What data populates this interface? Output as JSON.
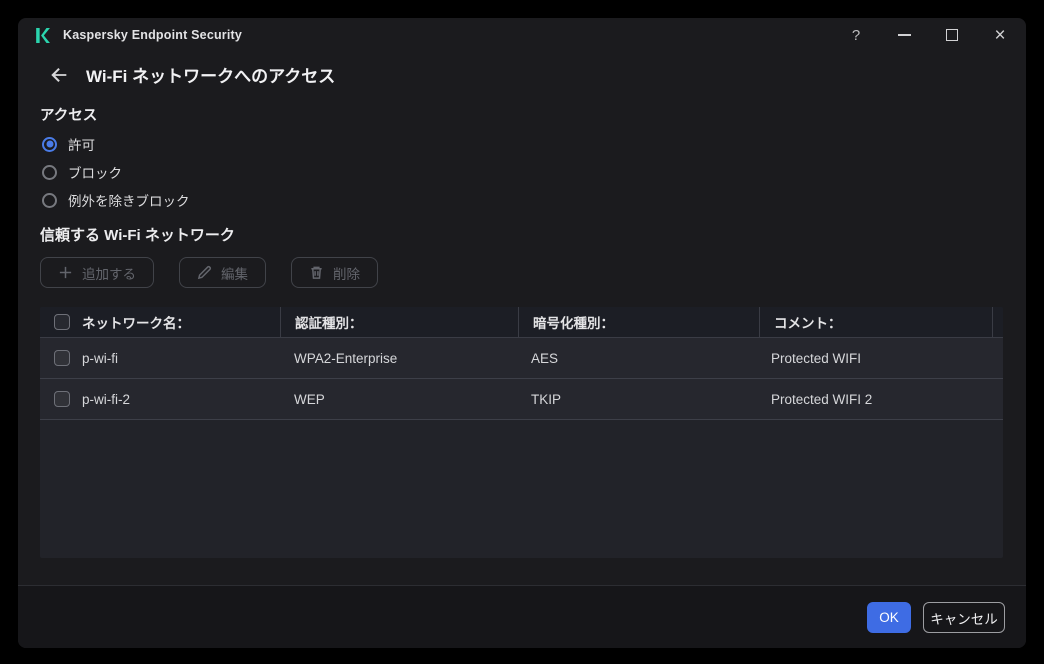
{
  "window": {
    "title": "Kaspersky Endpoint Security",
    "controls": {
      "help": "?",
      "close": "×"
    }
  },
  "header": {
    "title": "Wi-Fi ネットワークへのアクセス"
  },
  "access": {
    "label": "アクセス",
    "options": [
      {
        "label": "許可",
        "selected": true
      },
      {
        "label": "ブロック",
        "selected": false
      },
      {
        "label": "例外を除きブロック",
        "selected": false
      }
    ]
  },
  "trusted": {
    "label": "信頼する Wi-Fi ネットワーク",
    "toolbar": {
      "add": "追加する",
      "edit": "編集",
      "delete": "削除"
    },
    "table": {
      "columns": [
        "ネットワーク名：",
        "認証種別：",
        "暗号化種別：",
        "コメント："
      ],
      "rows": [
        {
          "name": "p-wi-fi",
          "auth": "WPA2-Enterprise",
          "encryption": "AES",
          "comment": "Protected WIFI",
          "checked": false
        },
        {
          "name": "p-wi-fi-2",
          "auth": "WEP",
          "encryption": "TKIP",
          "comment": "Protected WIFI 2",
          "checked": false
        }
      ]
    }
  },
  "footer": {
    "ok": "OK",
    "cancel": "キャンセル"
  },
  "colors": {
    "accent": "#3e6ce4",
    "logo": "#2bd5ae",
    "row_bg": "#26272e",
    "header_bg": "#1c1e25"
  }
}
